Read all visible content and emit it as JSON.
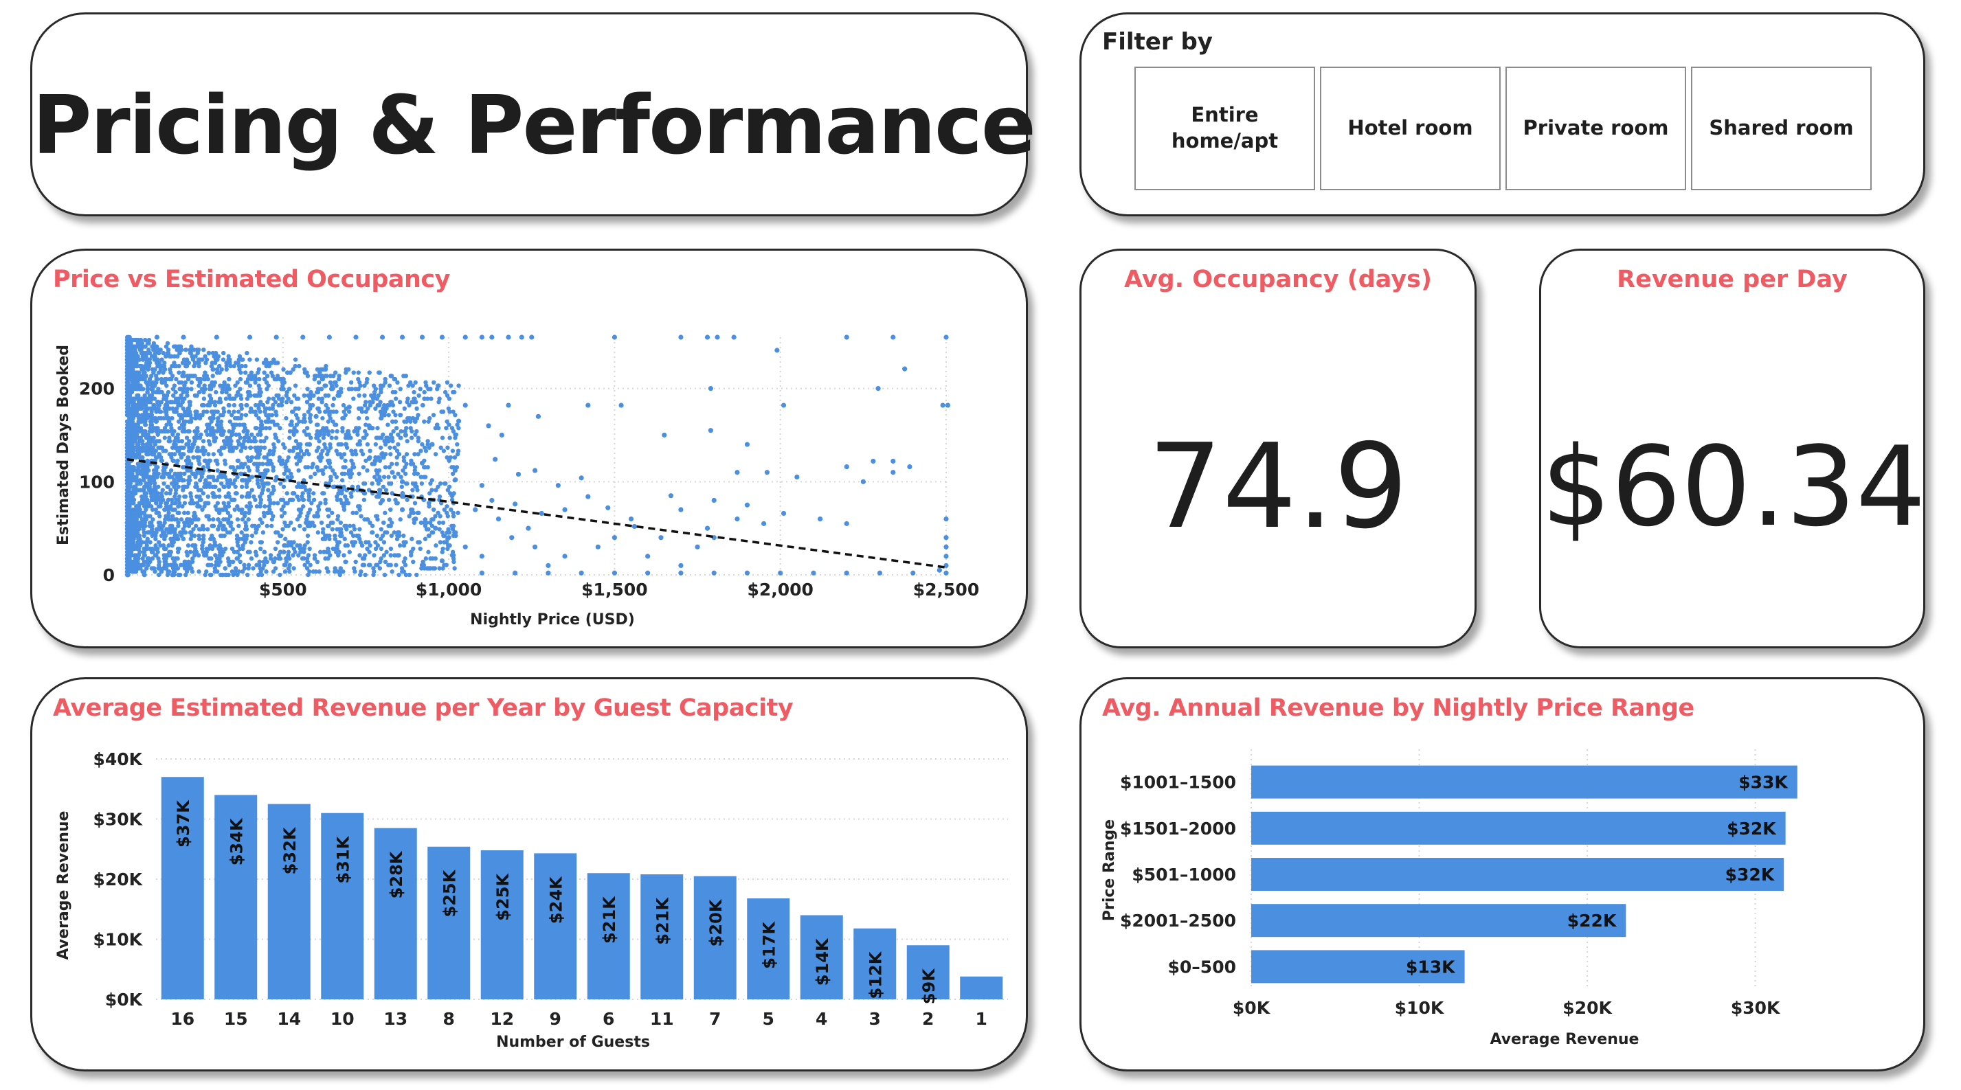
{
  "header": {
    "title": "Pricing & Performance"
  },
  "filter": {
    "label": "Filter by",
    "options": [
      "Entire home/apt",
      "Hotel room",
      "Private room",
      "Shared room"
    ]
  },
  "kpis": {
    "occupancy": {
      "title": "Avg. Occupancy (days)",
      "value": "74.9"
    },
    "revenue_day": {
      "title": "Revenue per Day",
      "value": "$60.34"
    }
  },
  "colors": {
    "accent": "#ef5b63",
    "bar": "#4a8fe0",
    "text": "#1e1e1e"
  },
  "chart_data": [
    {
      "id": "scatter",
      "type": "scatter",
      "title": "Price vs Estimated Occupancy",
      "xlabel": "Nightly Price (USD)",
      "ylabel": "Estimated Days Booked",
      "xlim": [
        30,
        2500
      ],
      "ylim": [
        0,
        255
      ],
      "x_ticks": [
        500,
        1000,
        1500,
        2000,
        2500
      ],
      "x_tick_labels": [
        "$500",
        "$1,000",
        "$1,500",
        "$2,000",
        "$2,500"
      ],
      "y_ticks": [
        0,
        100,
        200
      ],
      "y_tick_labels": [
        "0",
        "100",
        "200"
      ],
      "trendline": {
        "x": [
          30,
          2500
        ],
        "y": [
          124,
          8
        ]
      },
      "grid": true,
      "points": [
        [
          120,
          255
        ],
        [
          200,
          255
        ],
        [
          300,
          255
        ],
        [
          400,
          255
        ],
        [
          480,
          255
        ],
        [
          560,
          255
        ],
        [
          640,
          255
        ],
        [
          720,
          255
        ],
        [
          800,
          255
        ],
        [
          860,
          255
        ],
        [
          920,
          255
        ],
        [
          980,
          255
        ],
        [
          1050,
          255
        ],
        [
          1100,
          255
        ],
        [
          1130,
          255
        ],
        [
          1180,
          255
        ],
        [
          1220,
          255
        ],
        [
          1250,
          255
        ],
        [
          1500,
          255
        ],
        [
          1700,
          255
        ],
        [
          1780,
          255
        ],
        [
          1810,
          255
        ],
        [
          1860,
          255
        ],
        [
          2200,
          255
        ],
        [
          2340,
          255
        ],
        [
          2500,
          255
        ],
        [
          1990,
          241
        ],
        [
          2375,
          221
        ],
        [
          2295,
          200
        ],
        [
          2490,
          182
        ],
        [
          2505,
          182
        ],
        [
          1420,
          182
        ],
        [
          1520,
          182
        ],
        [
          1050,
          182
        ],
        [
          1180,
          182
        ],
        [
          1790,
          200
        ],
        [
          1270,
          170
        ],
        [
          2010,
          182
        ],
        [
          1650,
          150
        ],
        [
          1790,
          155
        ],
        [
          1900,
          140
        ],
        [
          1030,
          165
        ],
        [
          1120,
          160
        ],
        [
          1160,
          150
        ],
        [
          2280,
          122
        ],
        [
          2340,
          122
        ],
        [
          2390,
          116
        ],
        [
          2200,
          116
        ],
        [
          2340,
          110
        ],
        [
          2250,
          100
        ],
        [
          1960,
          110
        ],
        [
          1870,
          110
        ],
        [
          2050,
          105
        ],
        [
          2010,
          66
        ],
        [
          2120,
          60
        ],
        [
          2200,
          55
        ],
        [
          1670,
          85
        ],
        [
          1700,
          70
        ],
        [
          1800,
          80
        ],
        [
          1900,
          75
        ],
        [
          1950,
          55
        ],
        [
          1870,
          60
        ],
        [
          1780,
          50
        ],
        [
          1640,
          40
        ],
        [
          1560,
          52
        ],
        [
          1480,
          72
        ],
        [
          1420,
          84
        ],
        [
          1330,
          96
        ],
        [
          1400,
          104
        ],
        [
          1210,
          108
        ],
        [
          1140,
          124
        ],
        [
          1260,
          112
        ],
        [
          1100,
          96
        ],
        [
          1020,
          102
        ],
        [
          2500,
          60
        ],
        [
          2500,
          40
        ],
        [
          2500,
          30
        ],
        [
          2500,
          20
        ],
        [
          2500,
          10
        ],
        [
          2500,
          2
        ],
        [
          2480,
          5
        ],
        [
          2400,
          2
        ],
        [
          2300,
          2
        ],
        [
          2200,
          2
        ],
        [
          2100,
          2
        ],
        [
          2000,
          2
        ],
        [
          1900,
          2
        ],
        [
          1800,
          2
        ],
        [
          1700,
          2
        ],
        [
          1600,
          2
        ],
        [
          1500,
          2
        ],
        [
          1400,
          2
        ],
        [
          1300,
          2
        ],
        [
          1200,
          2
        ],
        [
          1100,
          2
        ],
        [
          1300,
          10
        ],
        [
          1350,
          20
        ],
        [
          1260,
          30
        ],
        [
          1190,
          40
        ],
        [
          1240,
          50
        ],
        [
          1150,
          60
        ],
        [
          1080,
          70
        ],
        [
          1130,
          80
        ],
        [
          1000,
          40
        ],
        [
          1050,
          30
        ],
        [
          1100,
          20
        ],
        [
          980,
          15
        ],
        [
          1450,
          30
        ],
        [
          1500,
          40
        ],
        [
          1600,
          20
        ],
        [
          1700,
          10
        ],
        [
          1750,
          30
        ],
        [
          1800,
          40
        ],
        [
          1550,
          60
        ],
        [
          1350,
          70
        ],
        [
          1280,
          66
        ],
        [
          1200,
          76
        ],
        [
          950,
          140
        ],
        [
          870,
          150
        ],
        [
          920,
          120
        ],
        [
          860,
          100
        ],
        [
          800,
          130
        ],
        [
          760,
          160
        ],
        [
          700,
          180
        ],
        [
          650,
          200
        ],
        [
          600,
          170
        ],
        [
          580,
          140
        ],
        [
          640,
          120
        ],
        [
          700,
          110
        ],
        [
          740,
          90
        ],
        [
          800,
          80
        ],
        [
          860,
          70
        ],
        [
          900,
          60
        ],
        [
          960,
          50
        ],
        [
          1010,
          85
        ],
        [
          900,
          95
        ],
        [
          830,
          110
        ],
        [
          760,
          125
        ],
        [
          690,
          140
        ],
        [
          620,
          155
        ]
      ]
    },
    {
      "id": "guests",
      "type": "bar",
      "title": "Average Estimated Revenue per Year by Guest Capacity",
      "xlabel": "Number of Guests",
      "ylabel": "Average Revenue",
      "categories": [
        "16",
        "15",
        "14",
        "10",
        "13",
        "8",
        "12",
        "9",
        "6",
        "11",
        "7",
        "5",
        "4",
        "3",
        "2",
        "1"
      ],
      "values": [
        37000,
        34000,
        32500,
        31000,
        28500,
        25400,
        24800,
        24300,
        21000,
        20800,
        20500,
        16800,
        14000,
        11800,
        9000,
        3800
      ],
      "labels": [
        "$37K",
        "$34K",
        "$32K",
        "$31K",
        "$28K",
        "$25K",
        "$25K",
        "$24K",
        "$21K",
        "$21K",
        "$20K",
        "$17K",
        "$14K",
        "$12K",
        "$9K",
        ""
      ],
      "ylim": [
        0,
        40000
      ],
      "y_ticks": [
        0,
        10000,
        20000,
        30000,
        40000
      ],
      "y_tick_labels": [
        "$0K",
        "$10K",
        "$20K",
        "$30K",
        "$40K"
      ],
      "grid": true
    },
    {
      "id": "price-range",
      "type": "bar",
      "orientation": "horizontal",
      "title": "Avg. Annual Revenue by Nightly Price Range",
      "xlabel": "Average Revenue",
      "ylabel": "Price Range",
      "categories": [
        "$1001–1500",
        "$1501–2000",
        "$501–1000",
        "$2001–2500",
        "$0–500"
      ],
      "values": [
        32500,
        31800,
        31700,
        22300,
        12700
      ],
      "labels": [
        "$33K",
        "$32K",
        "$32K",
        "$22K",
        "$13K"
      ],
      "xlim": [
        0,
        33000
      ],
      "x_ticks": [
        0,
        10000,
        20000,
        30000
      ],
      "x_tick_labels": [
        "$0K",
        "$10K",
        "$20K",
        "$30K"
      ],
      "grid": true
    }
  ]
}
